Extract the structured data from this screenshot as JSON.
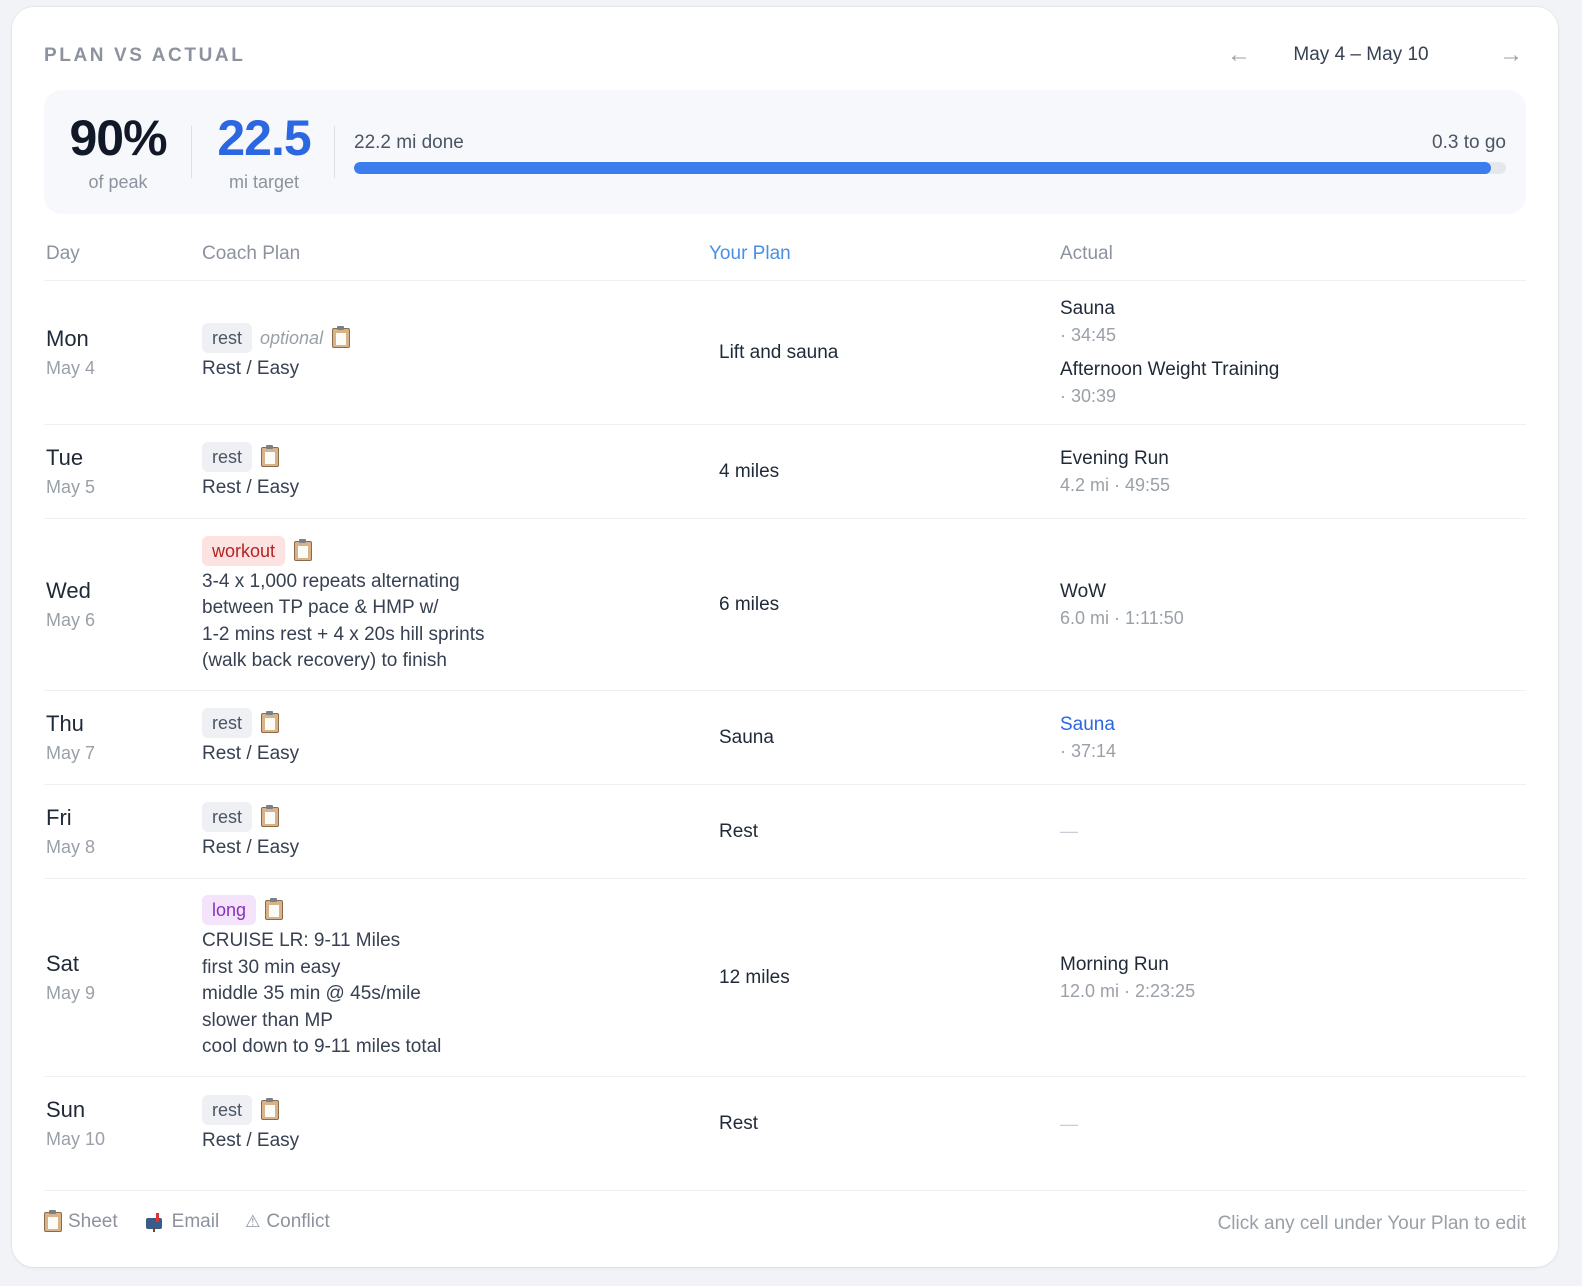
{
  "header": {
    "title": "PLAN VS ACTUAL",
    "range": "May 4 – May 10",
    "prev_icon": "←",
    "next_icon": "→"
  },
  "summary": {
    "peak_value": "90%",
    "peak_label": "of peak",
    "target_value": "22.5",
    "target_label": "mi target",
    "done_text": "22.2 mi done",
    "remaining_text": "0.3 to go",
    "progress_fraction": 0.987
  },
  "columns": {
    "day": "Day",
    "coach": "Coach Plan",
    "yours": "Your Plan",
    "actual": "Actual"
  },
  "rows": [
    {
      "day": "Mon",
      "date": "May 4",
      "tag": "rest",
      "tag_type": "rest",
      "optional": "optional",
      "coach": "Rest / Easy",
      "your_plan": "Lift and sauna",
      "actual": [
        {
          "title": "Sauna",
          "meta": "· 34:45"
        },
        {
          "title": "Afternoon Weight Training",
          "meta": "· 30:39"
        }
      ]
    },
    {
      "day": "Tue",
      "date": "May 5",
      "tag": "rest",
      "tag_type": "rest",
      "coach": "Rest / Easy",
      "your_plan": "4 miles",
      "actual": [
        {
          "title": "Evening Run",
          "meta": "4.2 mi · 49:55"
        }
      ]
    },
    {
      "day": "Wed",
      "date": "May 6",
      "tag": "workout",
      "tag_type": "workout",
      "coach": "3-4 x 1,000 repeats alternating\nbetween TP pace & HMP w/\n1-2 mins rest + 4 x 20s hill sprints\n(walk back recovery) to finish",
      "your_plan": "6 miles",
      "actual": [
        {
          "title": "WoW",
          "meta": "6.0 mi · 1:11:50"
        }
      ]
    },
    {
      "day": "Thu",
      "date": "May 7",
      "tag": "rest",
      "tag_type": "rest",
      "coach": "Rest / Easy",
      "your_plan": "Sauna",
      "actual": [
        {
          "title": "Sauna",
          "meta": "· 37:14",
          "link": true
        }
      ]
    },
    {
      "day": "Fri",
      "date": "May 8",
      "tag": "rest",
      "tag_type": "rest",
      "coach": "Rest / Easy",
      "your_plan": "Rest",
      "actual": [],
      "actual_none": "—"
    },
    {
      "day": "Sat",
      "date": "May 9",
      "tag": "long",
      "tag_type": "long",
      "coach": "CRUISE LR: 9-11 Miles\nfirst 30 min easy\nmiddle 35 min @ 45s/mile\nslower than MP\ncool down to 9-11 miles total",
      "your_plan": "12 miles",
      "actual": [
        {
          "title": "Morning Run",
          "meta": "12.0 mi · 2:23:25"
        }
      ]
    },
    {
      "day": "Sun",
      "date": "May 10",
      "tag": "rest",
      "tag_type": "rest",
      "coach": "Rest / Easy",
      "your_plan": "Rest",
      "actual": [],
      "actual_none": "—"
    }
  ],
  "footer": {
    "legend": [
      {
        "icon": "clipboard-icon",
        "label": "Sheet"
      },
      {
        "icon": "mailbox-icon",
        "label": "Email"
      },
      {
        "icon": "warning-icon",
        "label": "Conflict",
        "glyph": "⚠"
      }
    ],
    "hint": "Click any cell under Your Plan to edit"
  },
  "colors": {
    "accent_blue": "#2b67e0",
    "progress": "#3b7ded",
    "workout_tag_bg": "#fde2e2",
    "long_tag_bg": "#f3e3fb"
  }
}
